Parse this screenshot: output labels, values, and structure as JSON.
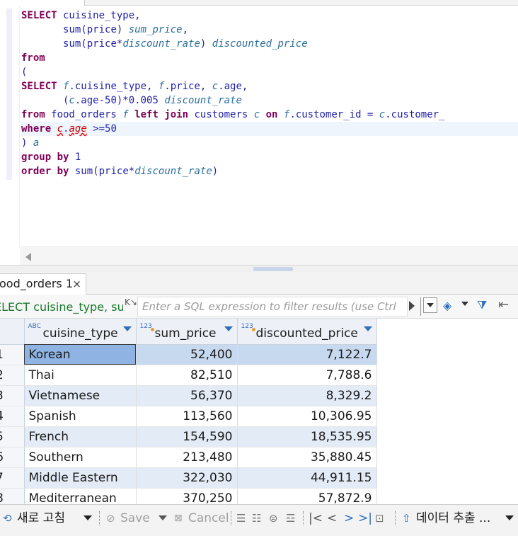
{
  "editor": {
    "lines": [
      [
        [
          "kw",
          "SELECT"
        ],
        [
          "id",
          " cuisine_type,"
        ]
      ],
      [
        [
          "id",
          "       "
        ],
        [
          "fn",
          "sum"
        ],
        [
          "id",
          "(price) "
        ],
        [
          "al",
          "sum_price"
        ],
        [
          "id",
          ","
        ]
      ],
      [
        [
          "id",
          "       "
        ],
        [
          "fn",
          "sum"
        ],
        [
          "id",
          "(price*"
        ],
        [
          "al",
          "discount_rate"
        ],
        [
          "id",
          ") "
        ],
        [
          "al",
          "discounted_price"
        ]
      ],
      [
        [
          "kw",
          "from"
        ]
      ],
      [
        [
          "id",
          "("
        ]
      ],
      [
        [
          "kw",
          "SELECT"
        ],
        [
          "id",
          " "
        ],
        [
          "al",
          "f"
        ],
        [
          "id",
          ".cuisine_type, "
        ],
        [
          "al",
          "f"
        ],
        [
          "id",
          ".price, "
        ],
        [
          "al",
          "c"
        ],
        [
          "id",
          ".age,"
        ]
      ],
      [
        [
          "id",
          "       ("
        ],
        [
          "al",
          "c"
        ],
        [
          "id",
          ".age-50)*0.005 "
        ],
        [
          "al",
          "discount_rate"
        ]
      ],
      [
        [
          "kw",
          "from"
        ],
        [
          "id",
          " food_orders "
        ],
        [
          "al",
          "f"
        ],
        [
          "id",
          " "
        ],
        [
          "kw",
          "left join"
        ],
        [
          "id",
          " customers "
        ],
        [
          "al",
          "c"
        ],
        [
          "id",
          " "
        ],
        [
          "kw",
          "on"
        ],
        [
          "id",
          " "
        ],
        [
          "al",
          "f"
        ],
        [
          "id",
          ".customer_id = "
        ],
        [
          "al",
          "c"
        ],
        [
          "id",
          ".customer_"
        ]
      ],
      [
        [
          "kw",
          "where"
        ],
        [
          "id",
          " "
        ],
        [
          "err",
          "c"
        ],
        [
          "id",
          "."
        ],
        [
          "err",
          "age"
        ],
        [
          "id",
          " >=50"
        ]
      ],
      [
        [
          "id",
          ") "
        ],
        [
          "al",
          "a"
        ]
      ],
      [
        [
          "kw",
          "group by"
        ],
        [
          "id",
          " 1"
        ]
      ],
      [
        [
          "kw",
          "order by"
        ],
        [
          "id",
          " "
        ],
        [
          "fn",
          "sum"
        ],
        [
          "id",
          "(price*"
        ],
        [
          "al",
          "discount_rate"
        ],
        [
          "id",
          ")"
        ]
      ]
    ],
    "highlighted_line": 8
  },
  "result_tab": {
    "label": "ood_orders 1",
    "close_glyph": "×"
  },
  "filter_bar": {
    "query_text": "ELECT cuisine_type, su",
    "placeholder": "Enter a SQL expression to filter results (use Ctrl",
    "filter_icon": "K↘",
    "eraser_icon": "◈",
    "funnel_icon": "⧩",
    "back_icon": "⇤"
  },
  "grid": {
    "columns": [
      {
        "badge": "ABC",
        "name": "cuisine_type"
      },
      {
        "badge": "123",
        "name": "sum_price"
      },
      {
        "badge": "123",
        "name": "discounted_price"
      }
    ],
    "rows": [
      {
        "n": "1",
        "cuisine_type": "Korean",
        "sum_price": "52,400",
        "discounted_price": "7,122.7"
      },
      {
        "n": "2",
        "cuisine_type": "Thai",
        "sum_price": "82,510",
        "discounted_price": "7,788.6"
      },
      {
        "n": "3",
        "cuisine_type": "Vietnamese",
        "sum_price": "56,370",
        "discounted_price": "8,329.2"
      },
      {
        "n": "4",
        "cuisine_type": "Spanish",
        "sum_price": "113,560",
        "discounted_price": "10,306.95"
      },
      {
        "n": "5",
        "cuisine_type": "French",
        "sum_price": "154,590",
        "discounted_price": "18,535.95"
      },
      {
        "n": "6",
        "cuisine_type": "Southern",
        "sum_price": "213,480",
        "discounted_price": "35,880.45"
      },
      {
        "n": "7",
        "cuisine_type": "Middle Eastern",
        "sum_price": "322,030",
        "discounted_price": "44,911.15"
      },
      {
        "n": "8",
        "cuisine_type": "Mediterranean",
        "sum_price": "370,250",
        "discounted_price": "57,872.9"
      }
    ]
  },
  "bottom_bar": {
    "refresh_label": "새로 고침",
    "save_label": "Save",
    "cancel_label": "Cancel",
    "export_label": "데이터 추출 ...",
    "icons": {
      "refresh": "⟲",
      "save": "⊘",
      "cancel": "⊠",
      "edit": "☰",
      "add_row": "☷",
      "copy_row": "⊜",
      "delete_row": "☲",
      "first": "|<",
      "prev": "<",
      "next": ">",
      "last": ">|",
      "fetch": "⊡",
      "export": "⇧"
    }
  },
  "colors": {
    "keyword": "#7f0055",
    "identifier": "#1f1fa8",
    "alias": "#2a6e9a",
    "error": "#d00000",
    "selected_row": "#c7d9ef",
    "striped_row": "#e3ebf6",
    "accent": "#2e6fb8"
  }
}
